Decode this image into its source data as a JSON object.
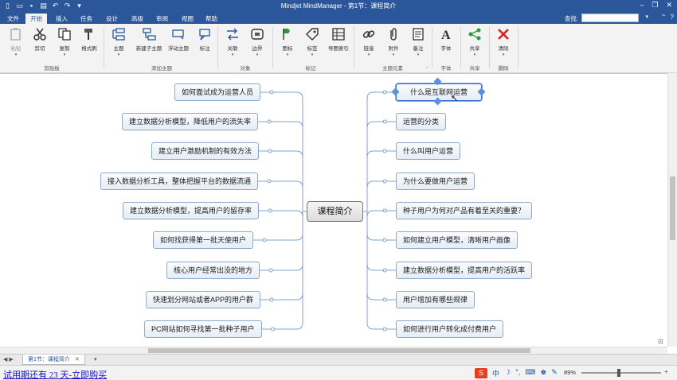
{
  "window": {
    "title": "Mindjet MindManager - 第1节：课程简介",
    "minimize": "–",
    "restore": "❐",
    "close": "✕"
  },
  "tabs": [
    {
      "label": "文件",
      "active": false
    },
    {
      "label": "开始",
      "active": true
    },
    {
      "label": "插入",
      "active": false
    },
    {
      "label": "任务",
      "active": false
    },
    {
      "label": "设计",
      "active": false
    },
    {
      "label": "高级",
      "active": false
    },
    {
      "label": "审阅",
      "active": false
    },
    {
      "label": "视图",
      "active": false
    },
    {
      "label": "帮助",
      "active": false
    }
  ],
  "search_label": "查找:",
  "ribbon": {
    "groups": [
      {
        "label": "剪贴板",
        "buttons": [
          {
            "label": "粘贴",
            "icon": "paste-icon",
            "disabled": true
          },
          {
            "label": "剪切",
            "icon": "scissors-icon",
            "disabled": false
          },
          {
            "label": "复制",
            "icon": "copy-icon",
            "disabled": false
          },
          {
            "label": "格式刷",
            "icon": "format-painter-icon",
            "disabled": false
          }
        ]
      },
      {
        "label": "添加主题",
        "buttons": [
          {
            "label": "主题",
            "icon": "topic-icon"
          },
          {
            "label": "新建子主题",
            "icon": "subtopic-icon"
          },
          {
            "label": "浮动主题",
            "icon": "floating-topic-icon"
          },
          {
            "label": "标注",
            "icon": "callout-icon"
          }
        ]
      },
      {
        "label": "对象",
        "buttons": [
          {
            "label": "关联",
            "icon": "relationship-icon"
          },
          {
            "label": "边界",
            "icon": "boundary-icon"
          }
        ]
      },
      {
        "label": "标记",
        "buttons": [
          {
            "label": "图标",
            "icon": "markers-icon"
          },
          {
            "label": "标签",
            "icon": "tag-icon"
          },
          {
            "label": "导图索引",
            "icon": "map-index-icon"
          }
        ]
      },
      {
        "label": "主题元素",
        "buttons": [
          {
            "label": "链接",
            "icon": "link-icon"
          },
          {
            "label": "附件",
            "icon": "attachment-icon"
          },
          {
            "label": "备注",
            "icon": "notes-icon"
          }
        ]
      },
      {
        "label": "字体",
        "buttons": [
          {
            "label": "字体",
            "icon": "font-icon"
          }
        ]
      },
      {
        "label": "共享",
        "buttons": [
          {
            "label": "共享",
            "icon": "share-icon"
          }
        ]
      },
      {
        "label": "删除",
        "buttons": [
          {
            "label": "清除",
            "icon": "clear-icon"
          }
        ]
      }
    ]
  },
  "map": {
    "central": "课程简介",
    "left_topics": [
      "如何面试成为运营人员",
      "建立数据分析模型，降低用户的流失率",
      "建立用户激励机制的有效方法",
      "接入数据分析工具，整体把握平台的数据流通",
      "建立数据分析模型，提高用户的留存率",
      "如何找获得第一批天使用户",
      "核心用户经常出没的地方",
      "快速划分网站或者APP的用户群",
      "PC网站如何寻找第一批种子用户"
    ],
    "right_topics": [
      "什么是互联网运营",
      "运营的分类",
      "什么叫用户运营",
      "为什么要做用户运营",
      "种子用户为何对产品有着至关的重要？",
      "如何建立用户模型，清晰用户画像",
      "建立数据分析模型，提高用户的活跃率",
      "用户增加有哪些规律",
      "如何进行用户转化成付费用户"
    ]
  },
  "sheet_tab": "第1节：课程简介",
  "status": {
    "trial": "试用期还有 23 天-立即购买",
    "ime_logo": "S",
    "ime_lang": "中",
    "zoom": "89%"
  }
}
